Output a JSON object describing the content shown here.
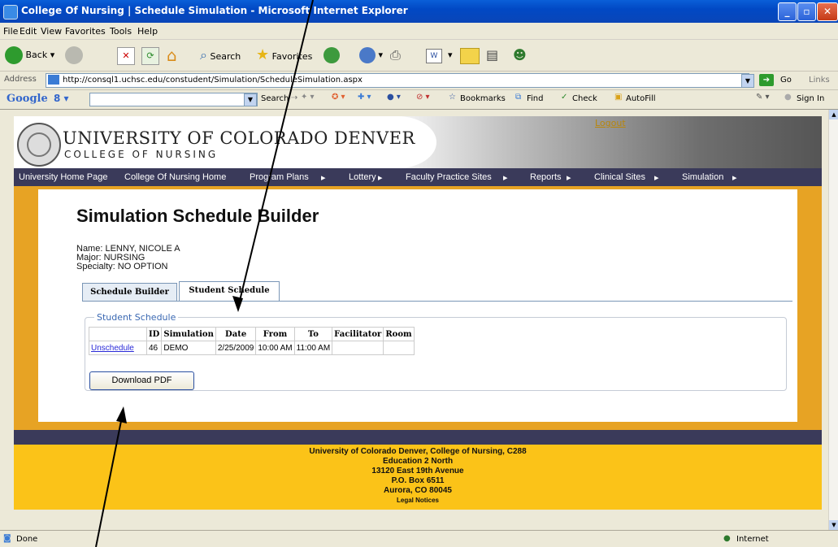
{
  "window": {
    "title": "College Of Nursing | Schedule Simulation - Microsoft Internet Explorer",
    "min": "_",
    "max": "▫",
    "close": "✕"
  },
  "menu": [
    "File",
    "Edit",
    "View",
    "Favorites",
    "Tools",
    "Help"
  ],
  "toolbar": {
    "back": "Back",
    "search": "Search",
    "favorites": "Favorites"
  },
  "address": {
    "label": "Address",
    "url": "http://consql1.uchsc.edu/constudent/Simulation/ScheduleSimulation.aspx",
    "go": "Go",
    "links": "Links"
  },
  "google_bar": {
    "logo": "Google",
    "search": "Search",
    "bookmarks": "Bookmarks",
    "find": "Find",
    "check": "Check",
    "autofill": "AutoFill",
    "signin": "Sign In"
  },
  "site": {
    "university": "UNIVERSITY OF COLORADO DENVER",
    "college": "COLLEGE OF NURSING",
    "logout": "Logout"
  },
  "nav": [
    "University Home Page",
    "College Of Nursing Home",
    "Program Plans",
    "Lottery",
    "Faculty Practice Sites",
    "Reports",
    "Clinical Sites",
    "Simulation"
  ],
  "main": {
    "heading": "Simulation Schedule Builder",
    "name_line": "Name: LENNY, NICOLE A",
    "major_line": "Major: NURSING",
    "specialty_line": "Specialty: NO OPTION",
    "tabs": [
      "Schedule Builder",
      "Student Schedule"
    ],
    "active_tab": "Student Schedule",
    "section_title": "Student Schedule",
    "table": {
      "headers": [
        "",
        "ID",
        "Simulation",
        "Date",
        "From",
        "To",
        "Facilitator",
        "Room"
      ],
      "rows": [
        [
          "Unschedule",
          "46",
          "DEMO",
          "2/25/2009",
          "10:00 AM",
          "11:00 AM",
          "",
          ""
        ]
      ]
    },
    "download_button": "Download PDF"
  },
  "footer": {
    "line1": "University of Colorado Denver, College of Nursing, C288",
    "line2": "Education 2 North",
    "line3": "13120 East 19th Avenue",
    "line4": "P.O. Box 6511",
    "line5": "Aurora, CO 80045",
    "legal": "Legal Notices"
  },
  "status": {
    "text": "Done",
    "zone": "Internet"
  }
}
